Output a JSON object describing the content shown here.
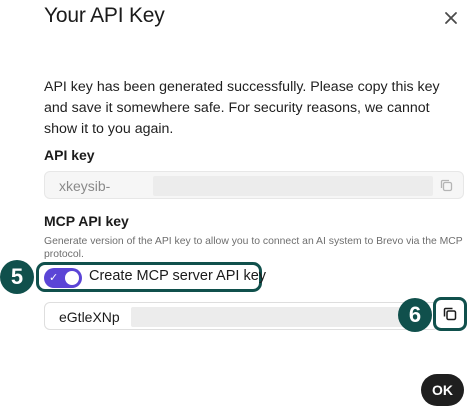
{
  "dialog": {
    "title": "Your API Key",
    "close_icon": "close-icon",
    "intro": "API key has been generated successfully. Please copy this key and save it somewhere safe. For security reasons, we cannot show it to you again."
  },
  "api_key": {
    "label": "API key",
    "value_visible": "xkeysib-",
    "copy_icon": "copy-icon"
  },
  "mcp_key": {
    "label": "MCP API key",
    "help": "Generate version of the API key to allow you to connect an AI system to Brevo via the MCP protocol.",
    "toggle_label": "Create MCP server API key",
    "toggle_on": true,
    "value_visible": "eGtleXNp",
    "copy_icon": "copy-icon"
  },
  "annotations": {
    "step_5": "5",
    "step_6": "6",
    "highlight_color": "#10504c"
  },
  "colors": {
    "toggle_accent": "#5b45d6",
    "ok_button_bg": "#1f1f1f"
  },
  "footer": {
    "ok_label": "OK"
  }
}
